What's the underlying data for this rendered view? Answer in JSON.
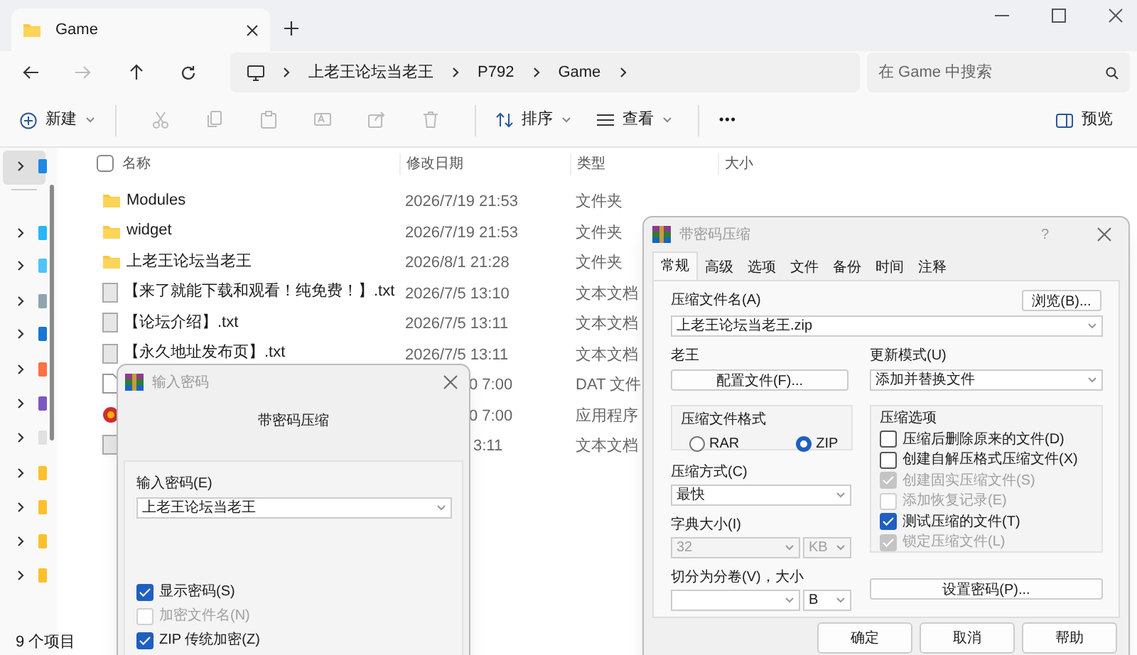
{
  "explorer": {
    "tab_title": "Game",
    "breadcrumb": [
      "上老王论坛当老王",
      "P792",
      "Game"
    ],
    "search": {
      "placeholder": "在 Game 中搜索"
    },
    "toolbar": [
      {
        "kind": "new",
        "label": "新建"
      },
      {
        "kind": "cut"
      },
      {
        "kind": "copy"
      },
      {
        "kind": "paste"
      },
      {
        "kind": "rename"
      },
      {
        "kind": "share"
      },
      {
        "kind": "delete"
      },
      {
        "kind": "sort",
        "label": "排序"
      },
      {
        "kind": "view",
        "label": "查看"
      },
      {
        "kind": "more",
        "label": "•••"
      }
    ],
    "preview": "预览",
    "columns": [
      "名称",
      "修改日期",
      "类型",
      "大小"
    ],
    "select_all": {
      "checked": false
    },
    "rows": [
      {
        "kind": "folder",
        "name": "Modules",
        "date": "2026/7/19 21:53",
        "type": "文件夹"
      },
      {
        "kind": "folder",
        "name": "widget",
        "date": "2026/7/19 21:53",
        "type": "文件夹"
      },
      {
        "kind": "folder",
        "name": "上老王论坛当老王",
        "date": "2026/8/1 21:28",
        "type": "文件夹"
      },
      {
        "kind": "text",
        "name": "【来了就能下载和观看！纯免费！】.txt",
        "date": "2026/7/5 13:10",
        "type": "文本文档"
      },
      {
        "kind": "text",
        "name": "【论坛介绍】.txt",
        "date": "2026/7/5 13:11",
        "type": "文本文档"
      },
      {
        "kind": "text",
        "name": "【永久地址发布页】.txt",
        "date": "2026/7/5 13:11",
        "type": "文本文档"
      },
      {
        "kind": "file",
        "date": "0 7:00",
        "type": "DAT 文件"
      },
      {
        "kind": "app",
        "date": "0 7:00",
        "type": "应用程序"
      },
      {
        "kind": "text",
        "date": "3:11",
        "type": "文本文档"
      }
    ],
    "status": "9 个项目"
  },
  "password_dialog": {
    "title": "输入密码",
    "heading": "带密码压缩",
    "password_label": "输入密码(E)",
    "password_value": "上老王论坛当老王",
    "checkboxes": [
      {
        "label": "显示密码(S)",
        "checked": true,
        "disabled": false
      },
      {
        "label": "加密文件名(N)",
        "checked": false,
        "disabled": true
      },
      {
        "label": "ZIP 传统加密(Z)",
        "checked": true,
        "disabled": false
      }
    ]
  },
  "archive_dialog": {
    "title": "带密码压缩",
    "help": "?",
    "tabs": [
      {
        "label": "常规",
        "selected": true
      },
      {
        "label": "高级",
        "selected": false
      },
      {
        "label": "选项",
        "selected": false
      },
      {
        "label": "文件",
        "selected": false
      },
      {
        "label": "备份",
        "selected": false
      },
      {
        "label": "时间",
        "selected": false
      },
      {
        "label": "注释",
        "selected": false
      }
    ],
    "archive_name_label": "压缩文件名(A)",
    "browse_button": "浏览(B)...",
    "archive_name": "上老王论坛当老王.zip",
    "profile_label": "老王",
    "profile_button": "配置文件(F)...",
    "update_mode_label": "更新模式(U)",
    "update_mode": "添加并替换文件",
    "format_group": "压缩文件格式",
    "formats": [
      {
        "label": "RAR",
        "selected": false
      },
      {
        "label": "ZIP",
        "selected": true
      }
    ],
    "method_label": "压缩方式(C)",
    "method": "最快",
    "dict_label": "字典大小(I)",
    "dict_size": "32",
    "dict_unit": "KB",
    "split_label": "切分为分卷(V)，大小",
    "split_unit": "B",
    "options_group": "压缩选项",
    "options": [
      {
        "label": "压缩后删除原来的文件(D)",
        "checked": false,
        "disabled": false
      },
      {
        "label": "创建自解压格式压缩文件(X)",
        "checked": false,
        "disabled": false
      },
      {
        "label": "创建固实压缩文件(S)",
        "checked": true,
        "disabled": true
      },
      {
        "label": "添加恢复记录(E)",
        "checked": false,
        "disabled": true
      },
      {
        "label": "测试压缩的文件(T)",
        "checked": true,
        "disabled": false
      },
      {
        "label": "锁定压缩文件(L)",
        "checked": true,
        "disabled": true
      }
    ],
    "password_button": "设置密码(P)...",
    "buttons": [
      "确定",
      "取消",
      "帮助"
    ]
  }
}
